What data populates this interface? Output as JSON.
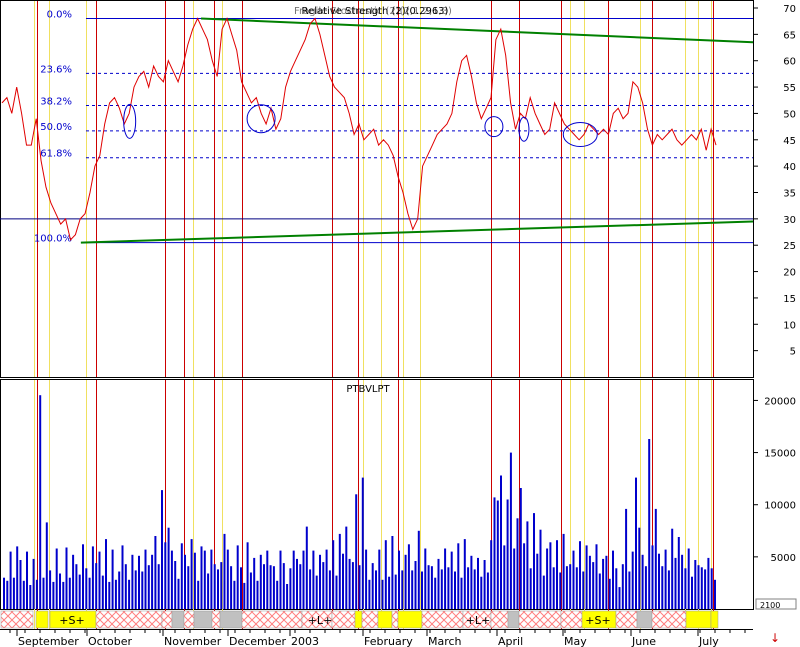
{
  "chart_data": [
    {
      "type": "line",
      "title": "Relative Strength (2)(0.2963)",
      "title_overlap": "Fragile Stochastic (2)(2,1,2,1,3)",
      "ylim": [
        0,
        70
      ],
      "y_ticks": [
        "5",
        "10",
        "15",
        "20",
        "25",
        "30",
        "35",
        "40",
        "45",
        "50",
        "55",
        "60",
        "65",
        "70"
      ],
      "price_series": [
        52,
        53,
        50,
        55,
        50,
        44,
        44,
        49,
        41,
        36,
        33,
        31,
        29,
        30,
        26,
        27,
        30,
        31,
        35,
        40,
        42,
        48,
        52,
        53,
        51,
        48,
        50,
        55,
        57,
        58,
        55,
        59,
        57,
        56,
        60,
        58,
        56,
        59,
        63,
        66,
        68,
        66,
        64,
        60,
        57,
        66,
        68,
        65,
        62,
        56,
        54,
        52,
        53,
        50,
        48,
        51,
        47,
        49,
        55,
        58,
        60,
        62,
        64,
        67,
        68,
        65,
        61,
        57,
        55,
        54,
        53,
        50,
        46,
        48,
        45,
        46,
        47,
        44,
        45,
        44,
        42,
        38,
        35,
        31,
        28,
        30,
        40,
        42,
        44,
        46,
        47,
        48,
        50,
        56,
        60,
        61,
        57,
        52,
        49,
        51,
        53,
        64,
        66,
        61,
        52,
        47,
        50,
        49,
        53,
        50,
        48,
        46,
        47,
        52,
        50,
        48,
        47,
        46,
        45,
        46,
        48,
        47,
        46,
        47,
        46,
        50,
        51,
        49,
        50,
        56,
        55,
        52,
        47,
        44,
        46,
        45,
        46,
        47,
        45,
        44,
        45,
        46,
        45,
        47,
        43,
        47,
        44
      ],
      "fibonacci": [
        {
          "label": "0.0%",
          "value": 68
        },
        {
          "label": "23.6%",
          "value": 57.6
        },
        {
          "label": "38.2%",
          "value": 51.5
        },
        {
          "label": "50.0%",
          "value": 46.7
        },
        {
          "label": "61.8%",
          "value": 41.6
        },
        {
          "label": "100.0%",
          "value": 25.5
        }
      ],
      "trendlines": [
        {
          "from": [
            0.265,
            68
          ],
          "to": [
            1.0,
            63.5
          ],
          "color": "#008000"
        },
        {
          "from": [
            0.105,
            25.5
          ],
          "to": [
            1.0,
            29.5
          ],
          "color": "#008000"
        }
      ],
      "circles": [
        {
          "x": 0.17,
          "y": 48.5
        },
        {
          "x": 0.345,
          "y": 49
        },
        {
          "x": 0.655,
          "y": 47.5
        },
        {
          "x": 0.695,
          "y": 47
        },
        {
          "x": 0.77,
          "y": 46
        }
      ],
      "horizontal_line_value": 30
    },
    {
      "type": "bar",
      "title": "PTBVLPT",
      "ylim": [
        0,
        21000
      ],
      "y_ticks": [
        "5000",
        "10000",
        "15000",
        "20000"
      ],
      "values": [
        3000,
        2700,
        5500,
        3000,
        6000,
        4700,
        2700,
        5500,
        2300,
        4800,
        2800,
        20500,
        3000,
        8300,
        3700,
        2600,
        5800,
        3400,
        2600,
        5900,
        3000,
        5200,
        4300,
        3300,
        6200,
        3900,
        3000,
        6000,
        4400,
        5500,
        3200,
        6700,
        2600,
        5700,
        2800,
        3600,
        6100,
        4300,
        2800,
        5200,
        3700,
        5100,
        3600,
        5700,
        4200,
        5200,
        7000,
        4300,
        11400,
        6400,
        7800,
        5600,
        4600,
        2900,
        6300,
        5200,
        4100,
        6700,
        5400,
        2700,
        6000,
        5600,
        3400,
        5700,
        4300,
        3800,
        4500,
        7200,
        5700,
        4100,
        2700,
        6100,
        4000,
        2500,
        6400,
        3500,
        4900,
        2700,
        5200,
        4300,
        5600,
        4200,
        4100,
        2700,
        5600,
        4400,
        2400,
        3900,
        5600,
        4800,
        4300,
        5600,
        7900,
        3800,
        5600,
        3200,
        5200,
        4500,
        5700,
        3700,
        6600,
        3200,
        7200,
        5300,
        7900,
        4800,
        4500,
        11000,
        4200,
        12600,
        5700,
        2800,
        4400,
        3700,
        5700,
        2800,
        6600,
        3100,
        7000,
        3300,
        5600,
        3700,
        5200,
        6200,
        3700,
        4600,
        7500,
        3600,
        5800,
        4200,
        4100,
        3000,
        4800,
        3800,
        5800,
        4000,
        5500,
        3600,
        6300,
        3000,
        6700,
        4000,
        5100,
        3800,
        4900,
        3100,
        4700,
        3500,
        6600,
        10700,
        10400,
        12800,
        6100,
        10500,
        15000,
        5800,
        8700,
        11600,
        6300,
        8400,
        3900,
        9200,
        5300,
        7600,
        3200,
        5800,
        6400,
        4000,
        6600,
        3500,
        7200,
        4100,
        4300,
        5600,
        4000,
        6500,
        3600,
        6100,
        5100,
        4500,
        6200,
        3400,
        4800,
        5100,
        2900,
        5600,
        3900,
        2100,
        4300,
        9600,
        3600,
        5500,
        12600,
        7800,
        5200,
        4100,
        16300,
        6100,
        9600,
        5300,
        4100,
        5700,
        3700,
        7700,
        4900,
        6900,
        5200,
        3900,
        5800,
        3100,
        4700,
        4200,
        4000,
        3800,
        4900,
        3900,
        2800
      ],
      "x_labels": [
        "September",
        "October",
        "November",
        "December",
        "2003",
        "February",
        "March",
        "April",
        "May",
        "June",
        "July"
      ],
      "band_labels": [
        "+S+",
        "+L+",
        "+L+",
        "+S+"
      ],
      "corner_label": "2100"
    }
  ],
  "colors": {
    "price_line": "#e00000",
    "volume_bar": "#0000cc",
    "red_vline": "#cc0000",
    "yellow_vline": "#f0e060",
    "fib_line": "#0000cc",
    "trendline": "#008000",
    "band_yellow": "#ffff00",
    "band_gray": "#c0c0c0",
    "band_hatch": "#ff8080"
  }
}
